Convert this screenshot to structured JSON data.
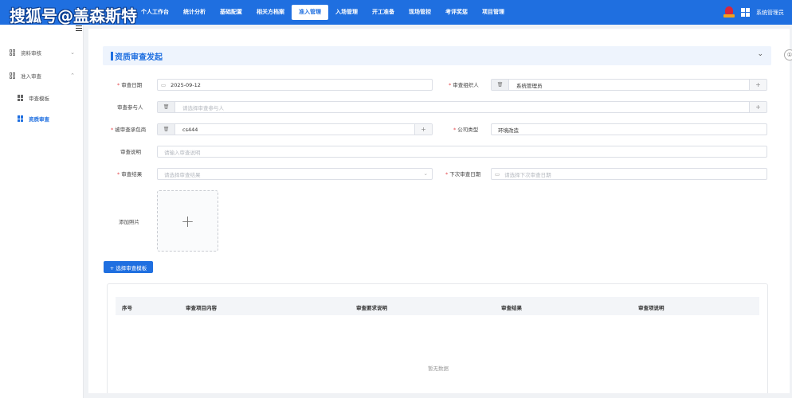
{
  "watermark": "搜狐号@盖森斯特",
  "nav": [
    "个人工作台",
    "统计分析",
    "基础配置",
    "相关方档案",
    "准入管理",
    "入场管理",
    "开工准备",
    "现场管控",
    "考评奖惩",
    "项目管理"
  ],
  "user": {
    "name": "系统管理员"
  },
  "sidebar": {
    "items": [
      {
        "label": "资料审核",
        "arrow": "⌄"
      },
      {
        "label": "准入审查",
        "arrow": "⌃"
      }
    ],
    "subitems": [
      {
        "label": "审查模板"
      },
      {
        "label": "资质审查"
      }
    ]
  },
  "right_btn": "①",
  "section": {
    "title": "资质审查发起",
    "chevron": "⌄"
  },
  "form": {
    "review_date": {
      "label": "审查日期",
      "value": "2025-09-12"
    },
    "organizer": {
      "label": "审查组织人",
      "value": "系统管理员"
    },
    "participants": {
      "label": "审查参与人",
      "placeholder": "请选择审查参与人"
    },
    "contractor": {
      "label": "被审查承包商",
      "value": "cs444"
    },
    "company_type": {
      "label": "公司类型",
      "value": "环境改造"
    },
    "description": {
      "label": "审查说明",
      "placeholder": "请输入审查说明"
    },
    "result": {
      "label": "审查结果",
      "placeholder": "请选择审查结果"
    },
    "next_date": {
      "label": "下次审查日期",
      "placeholder": "请选择下次审查日期"
    },
    "photo": {
      "label": "添加照片",
      "plus": "+"
    }
  },
  "template_button": "+ 选择审查模板",
  "table": {
    "headers": [
      "序号",
      "审查项目内容",
      "审查要求说明",
      "审查结果",
      "审查项说明"
    ],
    "empty": "暂无数据"
  }
}
